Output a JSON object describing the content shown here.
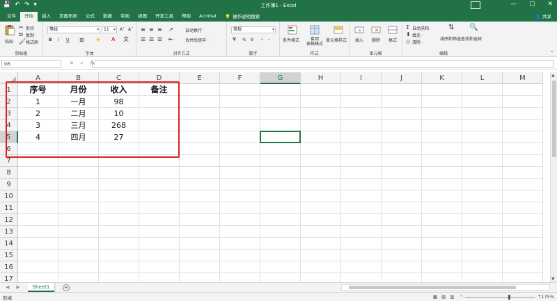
{
  "titlebar": {
    "title": "工作簿1 - Excel",
    "qat": [
      "💾",
      "↶",
      "↷",
      "▾"
    ],
    "winctl": [
      "—",
      "▢",
      "✕"
    ]
  },
  "tabs": [
    "文件",
    "开始",
    "插入",
    "页面布局",
    "公式",
    "数据",
    "审阅",
    "视图",
    "开发工具",
    "帮助",
    "Acrobat"
  ],
  "active_tab": "开始",
  "tell_me": "操作说明搜索",
  "share": "共享",
  "ribbon": {
    "clipboard": {
      "label": "剪贴板",
      "cut": "剪切",
      "copy": "复制 ·",
      "painter": "格式刷",
      "paste": "粘贴"
    },
    "font": {
      "label": "字体",
      "name": "等线",
      "size": "11",
      "bold": "B",
      "italic": "I",
      "underline": "U"
    },
    "alignment": {
      "label": "对齐方式",
      "wrap": "自动换行",
      "merge": "合并后居中 ·"
    },
    "number": {
      "label": "数字",
      "format": "常规",
      "pct": "%",
      "comma": "9"
    },
    "styles": {
      "label": "样式",
      "conditional": "条件格式",
      "table": "套用\n表格格式",
      "cell": "单元格样式"
    },
    "cells": {
      "label": "单元格",
      "insert": "插入",
      "delete": "删除",
      "format": "格式"
    },
    "editing": {
      "label": "编辑",
      "autosum": "自动求和 ·",
      "fill": "填充 ·",
      "clear": "清除 ·",
      "sort": "排序和筛选",
      "find": "查找和选择"
    }
  },
  "formula_bar": {
    "name_box": "G5",
    "fx": "fx",
    "value": ""
  },
  "grid": {
    "columns": [
      "A",
      "B",
      "C",
      "D",
      "E",
      "F",
      "G",
      "H",
      "I",
      "J",
      "K",
      "L",
      "M"
    ],
    "selected_column": "G",
    "rows": [
      "1",
      "2",
      "3",
      "4",
      "5",
      "6",
      "7",
      "8",
      "9",
      "10",
      "11",
      "12",
      "13",
      "14",
      "15",
      "16",
      "17"
    ],
    "selected_row": "5",
    "headers": [
      "序号",
      "月份",
      "收入",
      "备注"
    ],
    "data": [
      [
        "1",
        "一月",
        "98",
        ""
      ],
      [
        "2",
        "二月",
        "10",
        ""
      ],
      [
        "3",
        "三月",
        "268",
        ""
      ],
      [
        "4",
        "四月",
        "27",
        ""
      ]
    ]
  },
  "sheets": [
    "Sheet1"
  ],
  "status": {
    "ready": "就绪",
    "zoom": "175%"
  },
  "colors": {
    "accent": "#217346",
    "highlight": "#e02020"
  }
}
